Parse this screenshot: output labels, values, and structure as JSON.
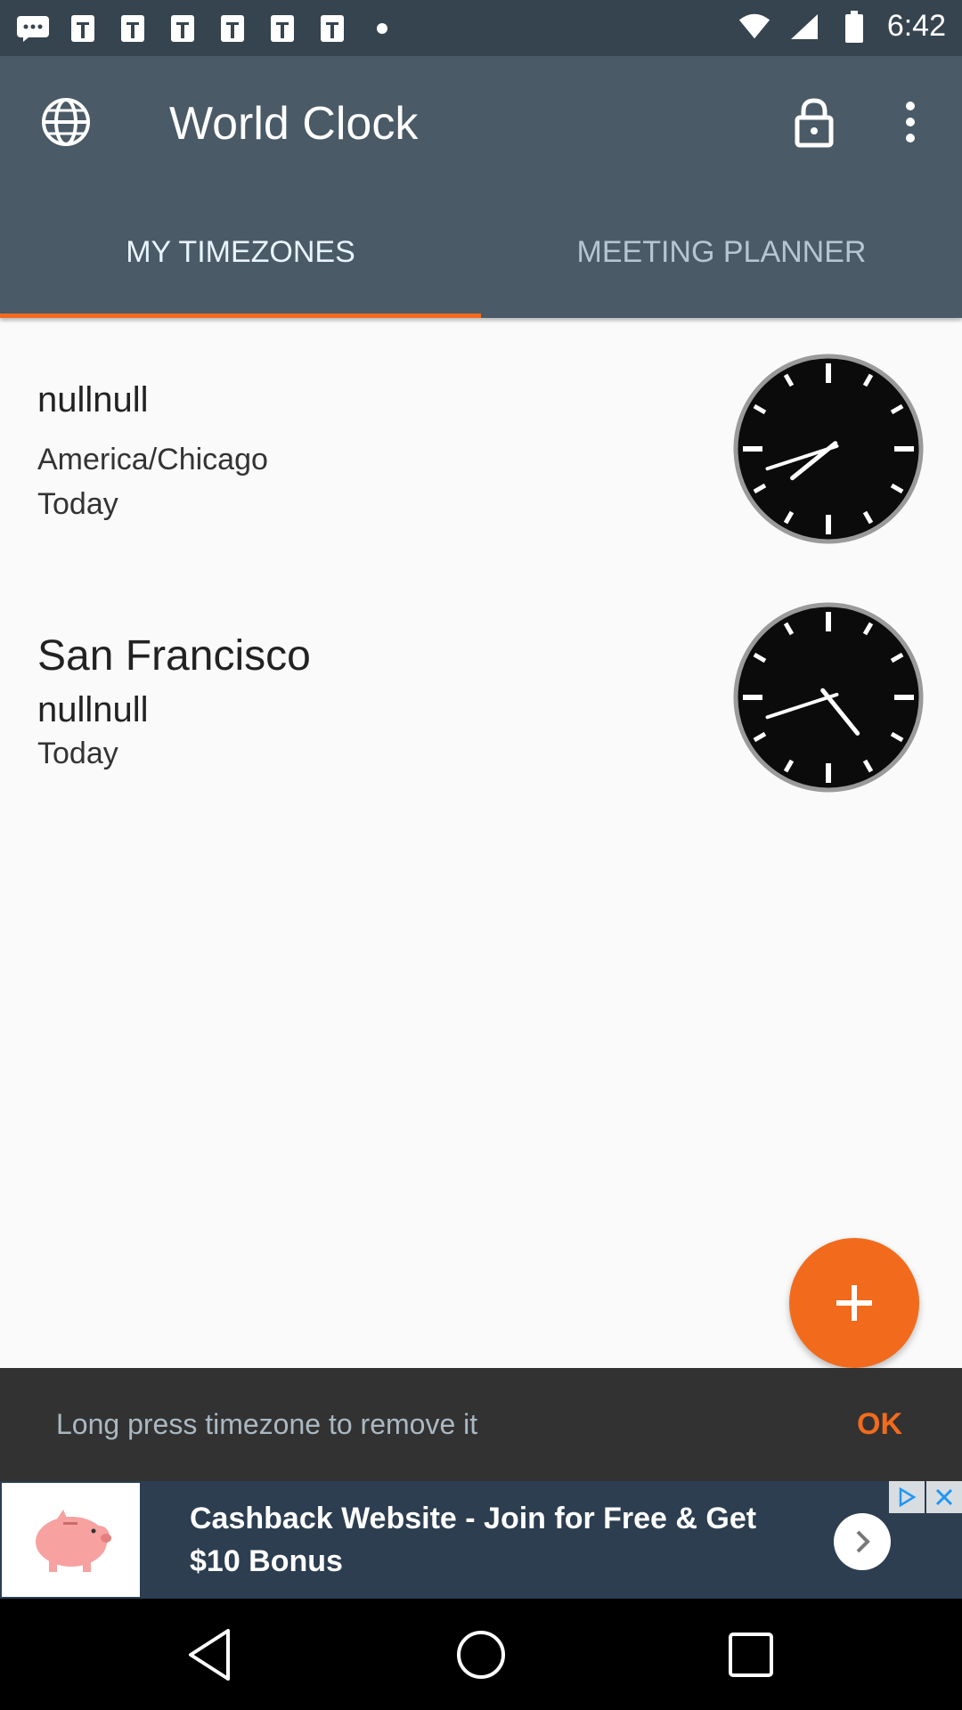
{
  "status_bar": {
    "time": "6:42",
    "icons_left": [
      "messages-icon",
      "notification-icon",
      "notification-icon",
      "notification-icon",
      "notification-icon",
      "notification-icon",
      "notification-icon",
      "more-dot-icon"
    ],
    "icons_right": [
      "wifi-icon",
      "cellular-icon",
      "battery-icon"
    ]
  },
  "app_bar": {
    "title": "World Clock",
    "icons": [
      "globe-icon",
      "lock-icon",
      "more-vert-icon"
    ]
  },
  "tabs": [
    {
      "label": "MY TIMEZONES",
      "selected": true
    },
    {
      "label": "MEETING PLANNER",
      "selected": false
    }
  ],
  "timezones": [
    {
      "line1": "nullnull",
      "line2": "America/Chicago",
      "line3": "Today",
      "clock": {
        "hour": 7,
        "minute": 42
      }
    },
    {
      "line1": "San Francisco",
      "line2": "nullnull",
      "line3": "Today",
      "clock": {
        "hour": 4,
        "minute": 42
      }
    }
  ],
  "fab": {
    "icon": "plus-icon"
  },
  "snackbar": {
    "message": "Long press timezone to remove it",
    "action": "OK"
  },
  "ad": {
    "text": "Cashback Website - Join for Free & Get $10 Bonus",
    "icon": "piggy-bank-icon"
  },
  "colors": {
    "primary": "#4a5a66",
    "accent": "#f26b1d",
    "background": "#fafafa"
  }
}
